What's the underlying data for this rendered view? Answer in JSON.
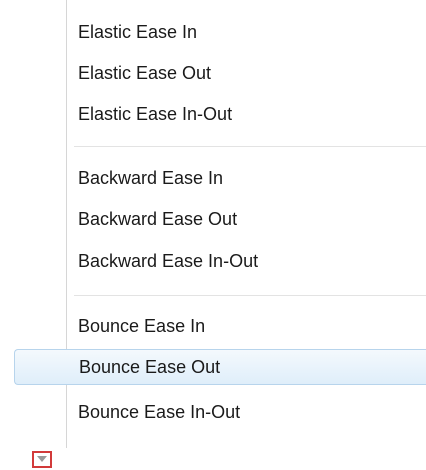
{
  "menu": {
    "groups": [
      {
        "items": [
          {
            "label": "Elastic Ease In"
          },
          {
            "label": "Elastic Ease Out"
          },
          {
            "label": "Elastic Ease In-Out"
          }
        ]
      },
      {
        "items": [
          {
            "label": "Backward Ease In"
          },
          {
            "label": "Backward Ease Out"
          },
          {
            "label": "Backward Ease In-Out"
          }
        ]
      },
      {
        "items": [
          {
            "label": "Bounce Ease In"
          },
          {
            "label": "Bounce Ease Out",
            "highlighted": true
          },
          {
            "label": "Bounce Ease In-Out"
          }
        ]
      }
    ],
    "scroll_indicator_icon": "chevron-down-icon",
    "colors": {
      "highlight_border": "#b7d4ec",
      "highlight_fill": "#dfeefa",
      "scroll_indicator_border": "#d23a3a"
    }
  }
}
